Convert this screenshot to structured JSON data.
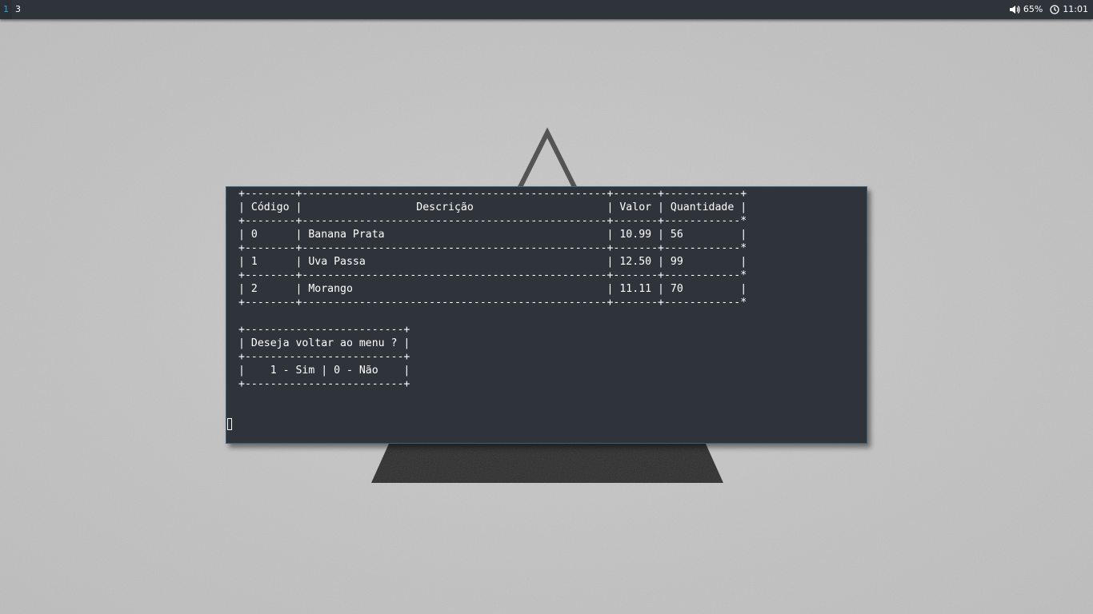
{
  "topbar": {
    "workspaces": [
      {
        "label": "1",
        "active": true
      },
      {
        "label": "3",
        "active": false
      }
    ],
    "volume": {
      "icon": "speaker-icon",
      "value": "65%"
    },
    "clock": {
      "icon": "clock-icon",
      "value": "11:01"
    },
    "accent_color": "#2f9ed8",
    "bar_color": "#2f343a"
  },
  "terminal": {
    "background": "#2f343a",
    "lines": [
      "+--------+------------------------------------------------+-------+------------+",
      "| Código |                  Descrição                     | Valor | Quantidade |",
      "+--------+------------------------------------------------+-------+------------*",
      "| 0      | Banana Prata                                   | 10.99 | 56         |",
      "+--------+------------------------------------------------+-------+------------*",
      "| 1      | Uva Passa                                      | 12.50 | 99         |",
      "+--------+------------------------------------------------+-------+------------*",
      "| 2      | Morango                                        | 11.11 | 70         |",
      "+--------+------------------------------------------------+-------+------------*",
      "",
      "+-------------------------+",
      "| Deseja voltar ao menu ? |",
      "+-------------------------+",
      "|    1 - Sim | 0 - Não    |",
      "+-------------------------+"
    ]
  }
}
